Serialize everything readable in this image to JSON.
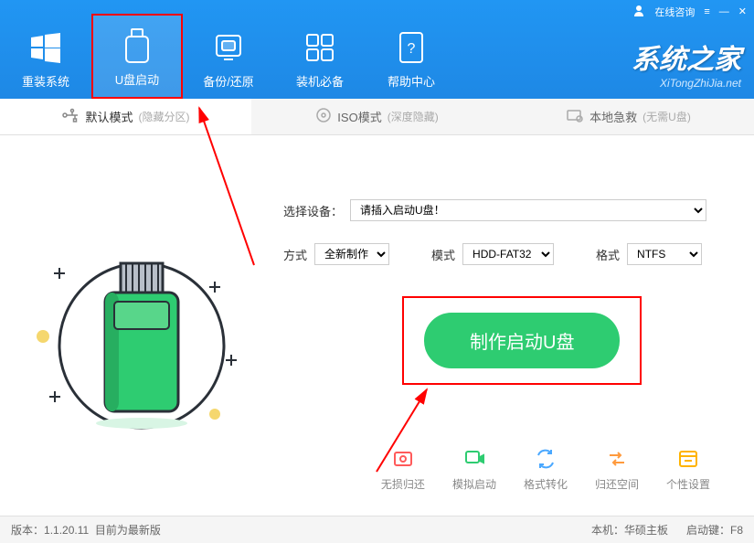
{
  "titlebar": {
    "consult": "在线咨询"
  },
  "nav": [
    {
      "label": "重装系统"
    },
    {
      "label": "U盘启动"
    },
    {
      "label": "备份/还原"
    },
    {
      "label": "装机必备"
    },
    {
      "label": "帮助中心"
    }
  ],
  "logo": {
    "main": "系统之家",
    "sub": "XiTongZhiJia.net"
  },
  "tabs": [
    {
      "label": "默认模式",
      "sub": "(隐藏分区)"
    },
    {
      "label": "ISO模式",
      "sub": "(深度隐藏)"
    },
    {
      "label": "本地急救",
      "sub": "(无需U盘)"
    }
  ],
  "form": {
    "device_label": "选择设备：",
    "device_value": "请插入启动U盘！",
    "method_label": "方式",
    "method_value": "全新制作",
    "mode_label": "模式",
    "mode_value": "HDD-FAT32",
    "format_label": "格式",
    "format_value": "NTFS"
  },
  "main_button": "制作启动U盘",
  "actions": [
    {
      "label": "无损归还",
      "color": "#ff5a5a"
    },
    {
      "label": "模拟启动",
      "color": "#2ecc71"
    },
    {
      "label": "格式转化",
      "color": "#4aa8ff"
    },
    {
      "label": "归还空间",
      "color": "#ff9a3d"
    },
    {
      "label": "个性设置",
      "color": "#ffb300"
    }
  ],
  "status": {
    "version_label": "版本：",
    "version": "1.1.20.11",
    "version_note": "目前为最新版",
    "machine_label": "本机：",
    "machine": "华硕主板",
    "bootkey_label": "启动键：",
    "bootkey": "F8"
  }
}
